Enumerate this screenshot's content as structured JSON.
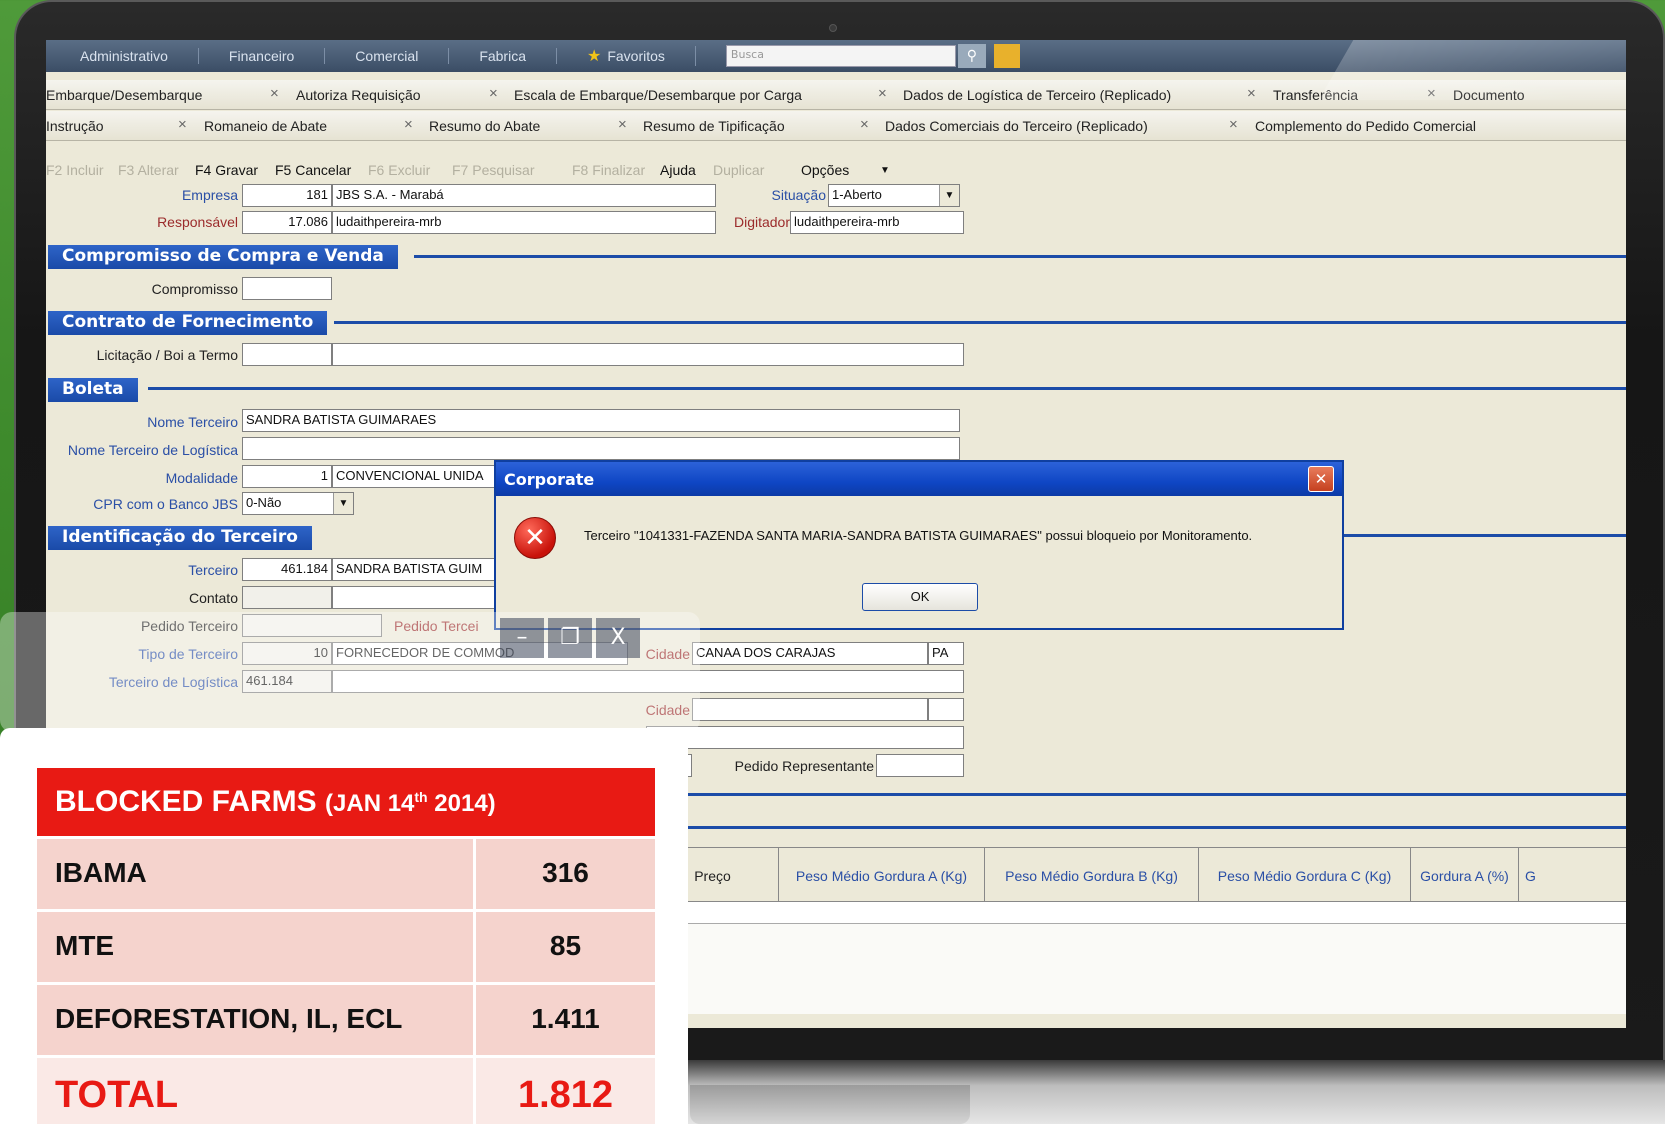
{
  "menu": {
    "items": [
      "Administrativo",
      "Financeiro",
      "Comercial",
      "Fabrica"
    ],
    "favorites": "Favoritos",
    "search_placeholder": "Busca"
  },
  "tabs_row1": [
    "Embarque/Desembarque",
    "Autoriza Requisição",
    "Escala de Embarque/Desembarque por Carga",
    "Dados de Logística de Terceiro (Replicado)",
    "Transferência",
    "Documento"
  ],
  "tabs_row2": [
    "Instrução",
    "Romaneio de Abate",
    "Resumo do Abate",
    "Resumo de Tipificação",
    "Dados Comerciais do Terceiro (Replicado)",
    "Complemento do Pedido Comercial"
  ],
  "toolbar": {
    "f2": "F2 Incluir",
    "f3": "F3 Alterar",
    "f4": "F4 Gravar",
    "f5": "F5 Cancelar",
    "f6": "F6 Excluir",
    "f7": "F7 Pesquisar",
    "f8": "F8 Finalizar",
    "help": "Ajuda",
    "duplicate": "Duplicar",
    "options": "Opções"
  },
  "form": {
    "empresa_label": "Empresa",
    "empresa_code": "181",
    "empresa_name": "JBS S.A. - Marabá",
    "situacao_label": "Situação",
    "situacao_value": "1-Aberto",
    "responsavel_label": "Responsável",
    "responsavel_code": "17.086",
    "responsavel_name": "ludaithpereira-mrb",
    "digitador_label": "Digitador",
    "digitador_value": "ludaithpereira-mrb",
    "sec_compromisso": "Compromisso de Compra e Venda",
    "compromisso_label": "Compromisso",
    "sec_contrato": "Contrato de Fornecimento",
    "licitacao_label": "Licitação / Boi a Termo",
    "sec_boleta": "Boleta",
    "nome_terceiro_label": "Nome Terceiro",
    "nome_terceiro_value": "SANDRA BATISTA GUIMARAES",
    "nome_terceiro_log_label": "Nome Terceiro de Logística",
    "modalidade_label": "Modalidade",
    "modalidade_code": "1",
    "modalidade_name": "CONVENCIONAL UNIDA",
    "cpr_label": "CPR com o Banco JBS",
    "cpr_value": "0-Não",
    "sec_identificacao": "Identificação do Terceiro",
    "terceiro_label": "Terceiro",
    "terceiro_code": "461.184",
    "terceiro_name": "SANDRA BATISTA GUIM",
    "contato_label": "Contato",
    "pedido_terceiro_label": "Pedido Terceiro",
    "pedido_terceiro_label2": "Pedido Tercei",
    "tipo_terceiro_label": "Tipo de Terceiro",
    "tipo_terceiro_code": "10",
    "tipo_terceiro_name": "FORNECEDOR DE COMMOD",
    "cidade_label": "Cidade",
    "cidade_value": "CANAA DOS CARAJAS",
    "uf_value": "PA",
    "terceiro_log_label": "Terceiro de Logística",
    "terceiro_log_value": "461.184",
    "cidade2_label": "Cidade",
    "pedido_rep_label": "Pedido Representante"
  },
  "grid_headers": [
    "Preço",
    "Peso Médio Gordura A (Kg)",
    "Peso Médio Gordura B (Kg)",
    "Peso Médio Gordura C (Kg)",
    "Gordura A (%)",
    "G"
  ],
  "dialog": {
    "title": "Corporate",
    "message": "Terceiro \"1041331-FAZENDA SANTA MARIA-SANDRA BATISTA GUIMARAES\" possui bloqueio por Monitoramento.",
    "ok": "OK"
  },
  "stats": {
    "title": "BLOCKED FARMS",
    "date_prefix": "(JAN 14",
    "date_sup": "th",
    "date_suffix": " 2014)",
    "rows": [
      {
        "name": "IBAMA",
        "value": "316"
      },
      {
        "name": "MTE",
        "value": "85"
      },
      {
        "name": "DEFORESTATION, IL, ECL",
        "value": "1.411"
      }
    ],
    "total_label": "TOTAL",
    "total_value": "1.812"
  },
  "colors": {
    "accent_red": "#e81a14",
    "section_blue": "#1c4ca8",
    "row_pink": "#f5d3cd"
  }
}
